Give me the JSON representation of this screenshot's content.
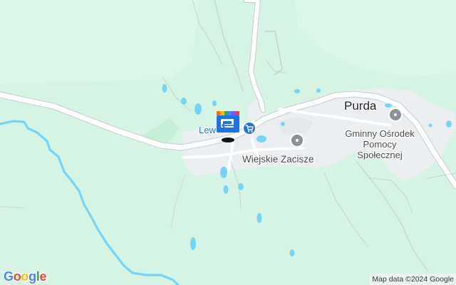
{
  "map": {
    "colors": {
      "forest": "#d6f4e4",
      "lighter_forest": "#dbf7e7",
      "built_up": "#eceff1",
      "river": "#73d6f8",
      "road": "#ffffff",
      "road_edge": "#c7ccd1",
      "path": "#a8b0b7",
      "village_label": "#1a73e8",
      "poi_icon": "#8a8f95"
    },
    "places": {
      "town": "Purda",
      "village": "Lew"
    },
    "pois": [
      {
        "name": "Wiejskie Zacisze",
        "icon": "place-pin-icon"
      },
      {
        "name": "Gminny Ośrodek Pomocy Społecznej",
        "icon": "place-pin-icon"
      }
    ],
    "markers": [
      {
        "name": "shopping-cart-icon"
      },
      {
        "name": "bus-stop-icon",
        "colors": [
          "#ff6d00",
          "#fbbc04",
          "#34a853",
          "#4285f4",
          "#a142f4",
          "#ea4335"
        ]
      }
    ],
    "branding": {
      "logo_letters": [
        {
          "char": "G",
          "color": "#4285f4"
        },
        {
          "char": "o",
          "color": "#ea4335"
        },
        {
          "char": "o",
          "color": "#fbbc04"
        },
        {
          "char": "g",
          "color": "#4285f4"
        },
        {
          "char": "l",
          "color": "#34a853"
        },
        {
          "char": "e",
          "color": "#ea4335"
        }
      ],
      "credits": "Map data ©2024 Google"
    }
  }
}
